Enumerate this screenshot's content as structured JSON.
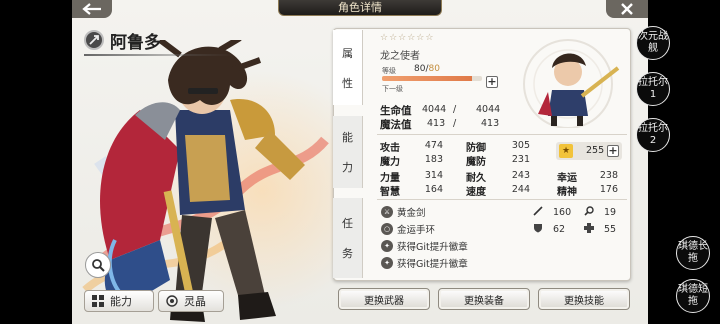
{
  "header": {
    "title": "角色详情"
  },
  "character": {
    "name": "阿鲁多"
  },
  "tabs": {
    "attributes": [
      "属",
      "性"
    ],
    "ability": [
      "能",
      "力"
    ],
    "mission": [
      "任",
      "务"
    ]
  },
  "profile": {
    "stars": "☆☆☆☆☆☆",
    "subtitle": "龙之使者",
    "level_label": "等级",
    "level_current": "80",
    "level_separator": "/",
    "level_max": "80",
    "level_progress": 0.9,
    "next_label": "下一级",
    "hp_label": "生命值",
    "hp_current": "4044",
    "hp_max": "4044",
    "mp_label": "魔法值",
    "mp_current": "413",
    "mp_max": "413",
    "separator": "/"
  },
  "stats": [
    {
      "label": "攻击",
      "value": "474"
    },
    {
      "label": "防御",
      "value": "305"
    },
    {
      "label": "魔力",
      "value": "183"
    },
    {
      "label": "魔防",
      "value": "231"
    },
    {
      "label": "力量",
      "value": "314"
    },
    {
      "label": "耐久",
      "value": "243"
    },
    {
      "label": "幸运",
      "value": "238"
    },
    {
      "label": "智慧",
      "value": "164"
    },
    {
      "label": "速度",
      "value": "244"
    },
    {
      "label": "精神",
      "value": "176"
    }
  ],
  "fame_value": "255",
  "equipment": [
    {
      "name": "黄金剑",
      "icon": "sword-icon"
    },
    {
      "name": "金运手环",
      "icon": "bracelet-icon"
    },
    {
      "name": "获得Git提升徽章",
      "icon": "badge-icon"
    },
    {
      "name": "获得Git提升徽章",
      "icon": "badge-icon"
    }
  ],
  "equip_stats": {
    "atk": "160",
    "crit": "19",
    "def": "62",
    "heal": "55"
  },
  "buttons": {
    "ability": "能力",
    "crystal": "灵晶",
    "change_weapon": "更换武器",
    "change_equipment": "更换装备",
    "change_skill": "更换技能"
  },
  "side_right": [
    {
      "label": "次元战舰"
    },
    {
      "label": "拉托尔1"
    },
    {
      "label": "拉托尔2"
    },
    {
      "label": "琪德长拖"
    },
    {
      "label": "琪德短拖"
    }
  ],
  "colors": {
    "accent": "#e07a48",
    "panel": "#faf9f6",
    "gold": "#c48f3f"
  }
}
